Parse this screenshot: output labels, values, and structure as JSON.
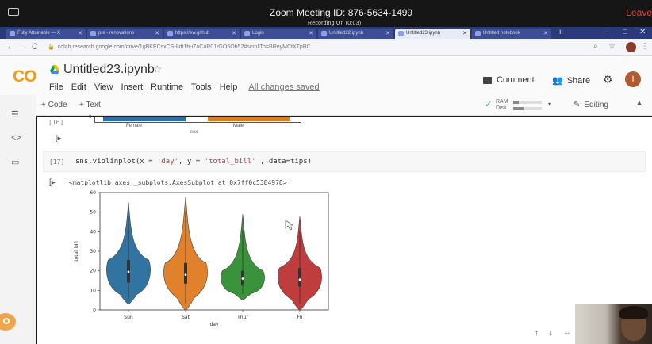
{
  "zoom": {
    "title": "Zoom Meeting ID: 876-5634-1499",
    "shared_label": "Recording On (0:03)",
    "leave_label": "Leave"
  },
  "browser": {
    "tabs": [
      {
        "label": "Fully Attainable — X"
      },
      {
        "label": "pre - renovations"
      },
      {
        "label": "https://ew.github"
      },
      {
        "label": "Login"
      },
      {
        "label": "Untitled22.ipynb"
      },
      {
        "label": "Untitled23.ipynb"
      },
      {
        "label": "Untitled notebook"
      }
    ],
    "url": "colab.research.google.com/drive/1gBKECsxCS-8dt1b-iZaCaR01rGO5Ob52#scrollTo=BReyMCtXTpBC"
  },
  "colab": {
    "logo": "CO",
    "notebook_title": "Untitled23.ipynb",
    "menu": [
      "File",
      "Edit",
      "View",
      "Insert",
      "Runtime",
      "Tools",
      "Help"
    ],
    "saved_status": "All changes saved",
    "comment_label": "Comment",
    "share_label": "Share",
    "avatar_initial": "I",
    "add_code": "+ Code",
    "add_text": "+ Text",
    "ram_label": "RAM",
    "disk_label": "Disk",
    "ram_fraction": 0.2,
    "disk_fraction": 0.35,
    "editing_label": "Editing"
  },
  "prev_cell": {
    "exec_count": "[16]",
    "zero_tick": "0",
    "categories": [
      "Female",
      "Male"
    ],
    "xlabel": "sex"
  },
  "code_cell": {
    "exec_count": "[17]",
    "code_prefix": "sns.violinplot(x = ",
    "arg_x": "'day'",
    "code_mid": ", y = ",
    "arg_y": "'total_bill'",
    "code_suffix": " , data=tips)"
  },
  "output": {
    "text": "<matplotlib.axes._subplots.AxesSubplot at 0x7ff0c5384978>"
  },
  "chart_data": {
    "type": "violin",
    "categories": [
      "Sun",
      "Sat",
      "Thur",
      "Fri"
    ],
    "xlabel": "day",
    "ylabel": "total_bill",
    "ylim": [
      0,
      60
    ],
    "yticks": [
      0,
      10,
      20,
      30,
      40,
      50,
      60
    ],
    "colors": [
      "#3274a1",
      "#e1812c",
      "#3a923a",
      "#c03d3e"
    ],
    "series": [
      {
        "min": 3,
        "max": 55,
        "q1": 14,
        "median": 19.5,
        "q3": 25.5
      },
      {
        "min": 0,
        "max": 58,
        "q1": 13.5,
        "median": 18,
        "q3": 24
      },
      {
        "min": 5,
        "max": 49,
        "q1": 12.5,
        "median": 16,
        "q3": 20
      },
      {
        "min": 0,
        "max": 48,
        "q1": 12,
        "median": 15.5,
        "q3": 21.5
      }
    ]
  }
}
